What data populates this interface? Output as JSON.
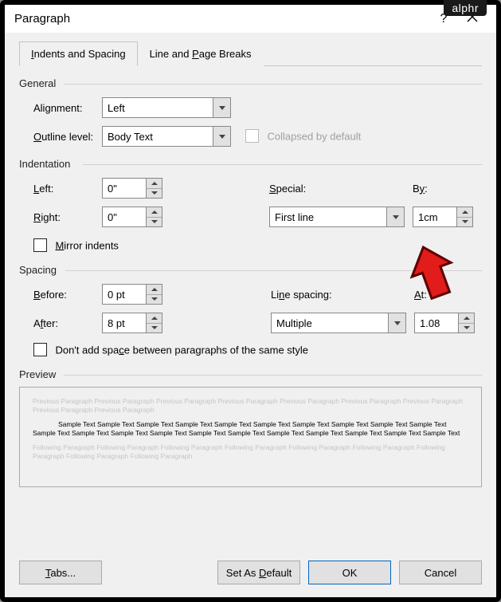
{
  "watermark": "alphr",
  "title": "Paragraph",
  "help_symbol": "?",
  "tabs": [
    {
      "label": "Indents and Spacing",
      "active": true
    },
    {
      "label": "Line and Page Breaks",
      "active": false
    }
  ],
  "general": {
    "title": "General",
    "alignment_label": "Alignment:",
    "alignment_value": "Left",
    "outline_label": "Outline level:",
    "outline_value": "Body Text",
    "collapsed_label": "Collapsed by default"
  },
  "indentation": {
    "title": "Indentation",
    "left_label": "Left:",
    "left_value": "0\"",
    "right_label": "Right:",
    "right_value": "0\"",
    "special_label": "Special:",
    "special_value": "First line",
    "by_label": "By:",
    "by_value": "1cm",
    "mirror_label": "Mirror indents"
  },
  "spacing": {
    "title": "Spacing",
    "before_label": "Before:",
    "before_value": "0 pt",
    "after_label": "After:",
    "after_value": "8 pt",
    "linespacing_label": "Line spacing:",
    "linespacing_value": "Multiple",
    "at_label": "At:",
    "at_value": "1.08",
    "nospace_label": "Don't add space between paragraphs of the same style"
  },
  "preview": {
    "title": "Preview",
    "prev_text": "Previous Paragraph Previous Paragraph Previous Paragraph Previous Paragraph Previous Paragraph Previous Paragraph Previous Paragraph Previous Paragraph Previous Paragraph",
    "sample_text": "Sample Text Sample Text Sample Text Sample Text Sample Text Sample Text Sample Text Sample Text Sample Text Sample Text Sample Text Sample Text Sample Text Sample Text Sample Text Sample Text Sample Text Sample Text Sample Text Sample Text Sample Text",
    "foll_text": "Following Paragraph Following Paragraph Following Paragraph Following Paragraph Following Paragraph Following Paragraph Following Paragraph Following Paragraph Following Paragraph"
  },
  "buttons": {
    "tabs": "Tabs...",
    "default": "Set As Default",
    "ok": "OK",
    "cancel": "Cancel"
  }
}
